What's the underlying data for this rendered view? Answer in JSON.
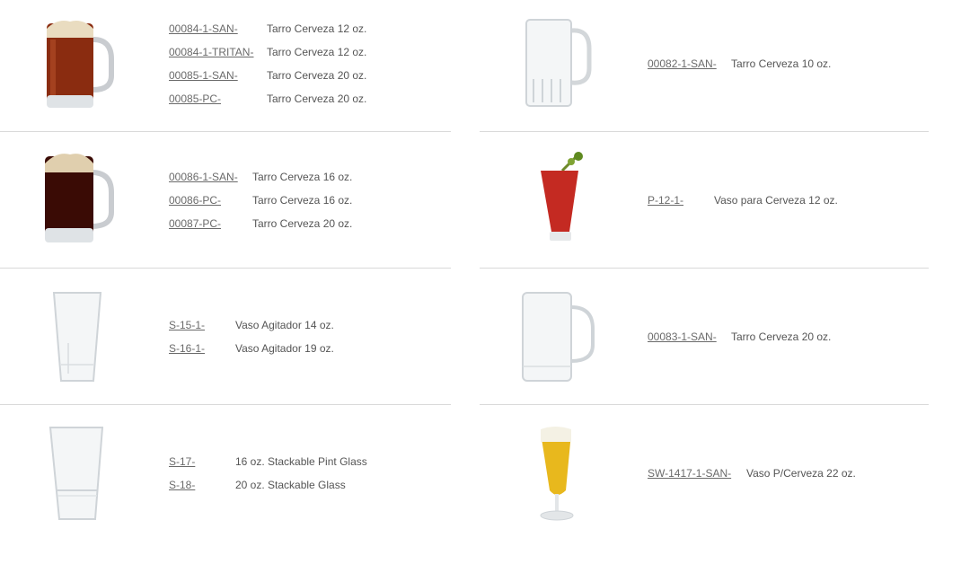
{
  "colors": {
    "text": "#555555",
    "link": "#6a6a6a",
    "separator": "#d9d9d9",
    "beer_amber": "#8a2c10",
    "beer_dark": "#3a0b05",
    "foam": "#e9dcc0",
    "tomato": "#c42a22",
    "lager": "#e8b81d"
  },
  "products": [
    {
      "image": "amber-beer-mug-icon",
      "items": [
        {
          "code": "00084-1-SAN-",
          "desc": "Tarro Cerveza 12 oz."
        },
        {
          "code": "00084-1-TRITAN-",
          "desc": "Tarro Cerveza 12 oz."
        },
        {
          "code": "00085-1-SAN-",
          "desc": "Tarro Cerveza 20 oz."
        },
        {
          "code": "00085-PC-",
          "desc": "Tarro Cerveza 20 oz."
        }
      ]
    },
    {
      "image": "empty-glass-mug-icon",
      "items": [
        {
          "code": "00082-1-SAN-",
          "desc": "Tarro Cerveza 10 oz."
        }
      ]
    },
    {
      "image": "dark-beer-mug-icon",
      "items": [
        {
          "code": "00086-1-SAN-",
          "desc": "Tarro Cerveza 16 oz."
        },
        {
          "code": "00086-PC-",
          "desc": "Tarro Cerveza 16 oz."
        },
        {
          "code": "00087-PC-",
          "desc": "Tarro Cerveza 20 oz."
        }
      ]
    },
    {
      "image": "bloody-mary-glass-icon",
      "items": [
        {
          "code": "P-12-1-",
          "desc": "Vaso para Cerveza 12 oz."
        }
      ]
    },
    {
      "image": "mixing-glass-icon",
      "items": [
        {
          "code": "S-15-1-",
          "desc": "Vaso Agitador 14 oz."
        },
        {
          "code": "S-16-1-",
          "desc": "Vaso Agitador 19 oz."
        }
      ]
    },
    {
      "image": "tall-glass-mug-icon",
      "items": [
        {
          "code": "00083-1-SAN-",
          "desc": "Tarro Cerveza 20 oz."
        }
      ]
    },
    {
      "image": "stackable-pint-glass-icon",
      "items": [
        {
          "code": "S-17-",
          "desc": "16 oz. Stackable Pint Glass"
        },
        {
          "code": "S-18-",
          "desc": "20 oz. Stackable Glass"
        }
      ]
    },
    {
      "image": "pilsner-beer-glass-icon",
      "items": [
        {
          "code": "SW-1417-1-SAN-",
          "desc": "Vaso P/Cerveza 22 oz."
        }
      ]
    }
  ]
}
